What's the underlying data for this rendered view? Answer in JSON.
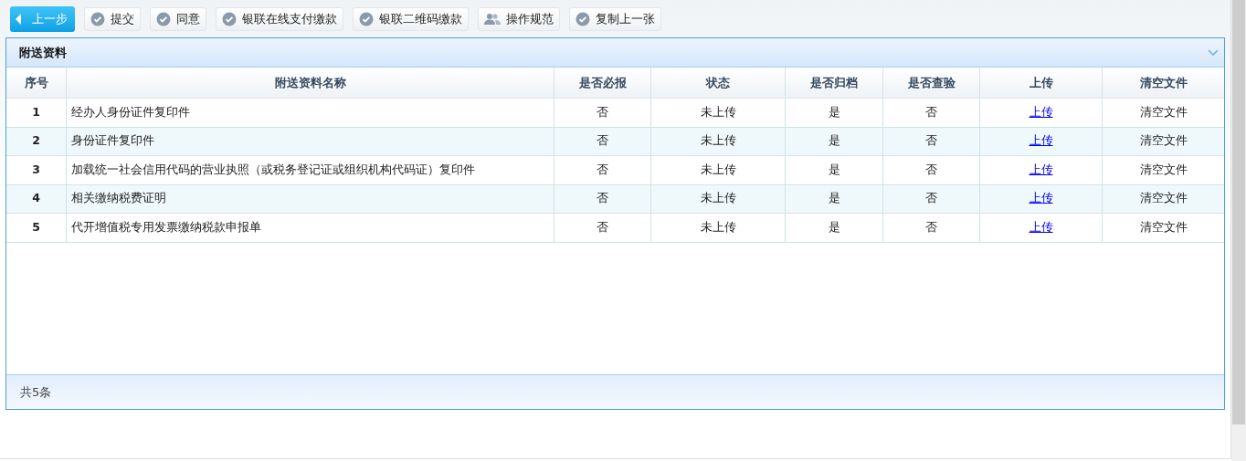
{
  "toolbar": [
    {
      "label": "上一步",
      "kind": "back"
    },
    {
      "label": "提交",
      "kind": "check"
    },
    {
      "label": "同意",
      "kind": "check"
    },
    {
      "label": "银联在线支付缴款",
      "kind": "check"
    },
    {
      "label": "银联二维码缴款",
      "kind": "check"
    },
    {
      "label": "操作规范",
      "kind": "people"
    },
    {
      "label": "复制上一张",
      "kind": "check"
    }
  ],
  "panel": {
    "title": "附送资料",
    "expanded": true
  },
  "table": {
    "columns": [
      "序号",
      "附送资料名称",
      "是否必报",
      "状态",
      "是否归档",
      "是否查验",
      "上传",
      "清空文件"
    ],
    "rows": [
      [
        "1",
        "经办人身份证件复印件",
        "否",
        "未上传",
        "是",
        "否",
        "上传",
        "清空文件"
      ],
      [
        "2",
        "身份证件复印件",
        "否",
        "未上传",
        "是",
        "否",
        "上传",
        "清空文件"
      ],
      [
        "3",
        "加载统一社会信用代码的营业执照（或税务登记证或组织机构代码证）复印件",
        "否",
        "未上传",
        "是",
        "否",
        "上传",
        "清空文件"
      ],
      [
        "4",
        "相关缴纳税费证明",
        "否",
        "未上传",
        "是",
        "否",
        "上传",
        "清空文件"
      ],
      [
        "5",
        "代开增值税专用发票缴纳税款申报单",
        "否",
        "未上传",
        "是",
        "否",
        "上传",
        "清空文件"
      ]
    ]
  },
  "footer": "共5条"
}
